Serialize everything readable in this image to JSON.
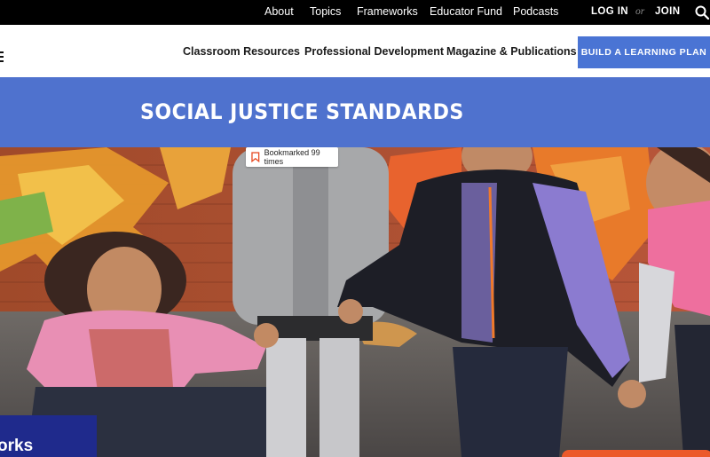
{
  "topbar": {
    "links": [
      "About",
      "Topics",
      "Frameworks",
      "Educator Fund",
      "Podcasts"
    ],
    "login": "LOG IN",
    "or": "or",
    "join": "JOIN",
    "search_icon": "search-icon"
  },
  "nav": {
    "menu_icon": "hamburger-menu-icon",
    "items": [
      "Classroom Resources",
      "Professional Development",
      "Magazine & Publications"
    ],
    "cta": "BUILD A LEARNING PLAN"
  },
  "banner": {
    "title": "SOCIAL JUSTICE STANDARDS"
  },
  "hero": {
    "bookmark": "Bookmarked 99 times",
    "bookmark_icon": "bookmark-icon",
    "frameworks_tab": "orks"
  },
  "colors": {
    "topbar": "#000000",
    "band": "#4f72ce",
    "cta": "#4a74d4",
    "frameworks_tab": "#1f2a8c",
    "accent_orange": "#ec5a2a"
  }
}
